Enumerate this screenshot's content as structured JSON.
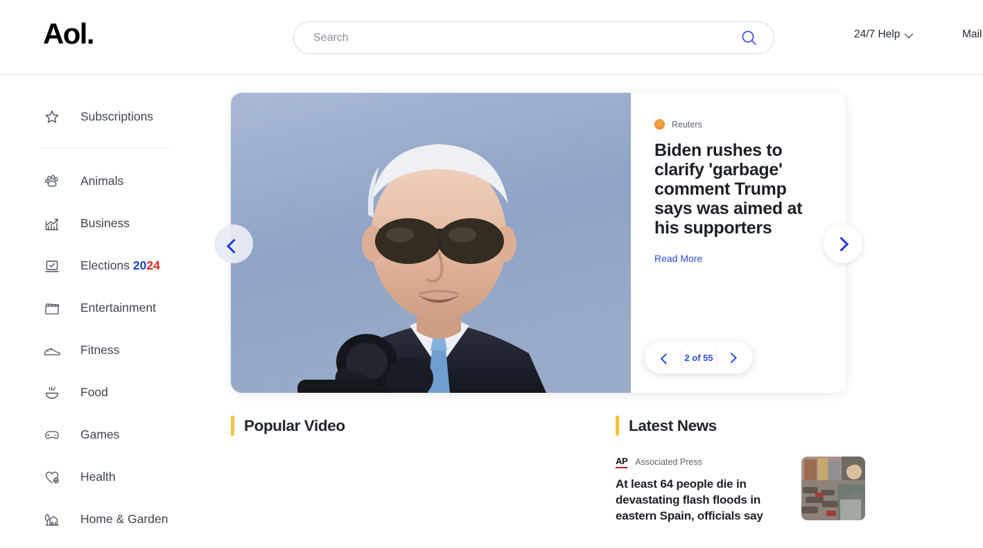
{
  "header": {
    "logo": "Aol.",
    "search": {
      "placeholder": "Search",
      "value": "",
      "icon": "search-icon"
    },
    "help_label": "24/7 Help",
    "mail_label": "Mail"
  },
  "sidebar": {
    "top_items": [
      {
        "label": "Subscriptions",
        "icon": "star-icon"
      }
    ],
    "items": [
      {
        "label": "Animals",
        "icon": "paw-icon"
      },
      {
        "label": "Business",
        "icon": "chart-growth-icon"
      },
      {
        "label": "Elections ",
        "label_blue": "20",
        "label_red": "24",
        "icon": "ballot-box-icon"
      },
      {
        "label": "Entertainment",
        "icon": "clapperboard-icon"
      },
      {
        "label": "Fitness",
        "icon": "sneaker-icon"
      },
      {
        "label": "Food",
        "icon": "bowl-icon"
      },
      {
        "label": "Games",
        "icon": "gamepad-icon"
      },
      {
        "label": "Health",
        "icon": "heart-plus-icon"
      },
      {
        "label": "Home & Garden",
        "icon": "house-tree-icon"
      }
    ]
  },
  "hero": {
    "source": "Reuters",
    "title": "Biden rushes to clarify 'garbage' comment Trump says was aimed at his supporters",
    "read_more": "Read More",
    "pager_label": "2 of 55",
    "prev_icon": "chevron-left-icon",
    "next_icon": "chevron-right-icon"
  },
  "sections": {
    "popular_video": {
      "title": "Popular Video"
    },
    "latest_news": {
      "title": "Latest News",
      "items": [
        {
          "source_logo": "AP",
          "source": "Associated Press",
          "title": "At least 64 people die in devastating flash floods in eastern Spain, officials say"
        }
      ]
    }
  },
  "colors": {
    "accent_yellow": "#f5c13e",
    "link_blue": "#2b4ae0",
    "election_blue": "#1c44d4",
    "election_red": "#d52b1e",
    "ap_red": "#d2112a"
  }
}
